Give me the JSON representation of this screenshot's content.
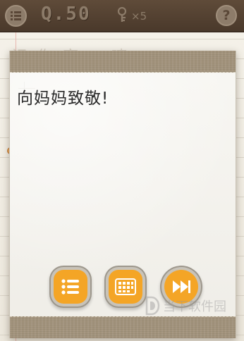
{
  "header": {
    "level": "Q.50",
    "key_count": "×5",
    "help_symbol": "?",
    "menu_icon": "menu-icon",
    "key_icon": "key-icon"
  },
  "background": {
    "faded_text": "记 你 家 > 咦"
  },
  "dialog": {
    "message": "向妈妈致敬!"
  },
  "buttons": [
    {
      "name": "level-list-button",
      "icon": "list-icon"
    },
    {
      "name": "level-select-button",
      "icon": "grid-icon"
    },
    {
      "name": "skip-button",
      "icon": "fast-forward-icon"
    }
  ],
  "watermark": {
    "text": "当下软件园",
    "logo": "d-logo-icon"
  },
  "colors": {
    "topbar": "#4f3d2e",
    "button_orange": "#f4a526",
    "tape": "#a1927b",
    "dialog_paper": "#f8f7f3"
  }
}
